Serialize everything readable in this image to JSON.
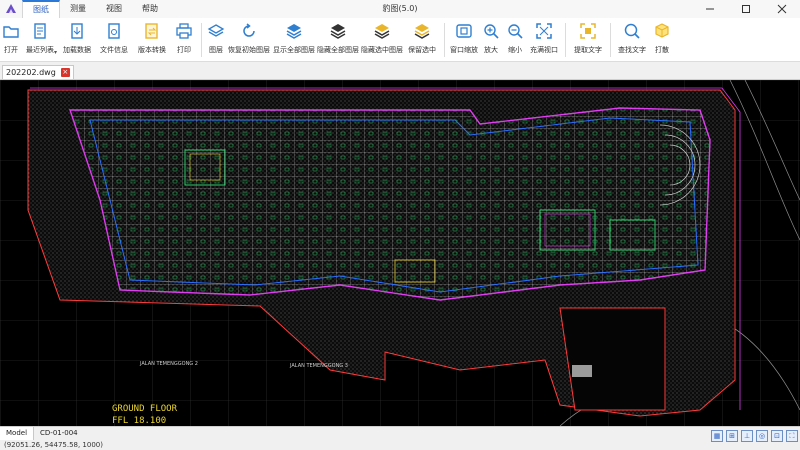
{
  "window": {
    "title": "豹图(5.0)"
  },
  "menu_tabs": [
    {
      "label": "图纸",
      "active": true
    },
    {
      "label": "测量"
    },
    {
      "label": "视图"
    },
    {
      "label": "帮助"
    }
  ],
  "ribbon": {
    "open": "打开",
    "recent": "最近列表",
    "load_data": "加载数据",
    "file_info": "文件信息",
    "version_convert": "版本转换",
    "print": "打印",
    "layers": "图层",
    "restore_layers": "恢复初始图层",
    "show_all_layers": "显示全部图层",
    "hide_all_layers": "隐藏全部图层",
    "hide_selected_layers": "隐藏选中图层",
    "keep_selected": "保留选中",
    "window_zoom": "窗口缩放",
    "zoom_in": "放大",
    "zoom_out": "缩小",
    "fill_viewport": "充满视口",
    "extract_text": "提取文字",
    "find_text": "查找文字",
    "hit": "打散"
  },
  "document": {
    "tab_name": "202202.dwg",
    "close_label": "×"
  },
  "drawing": {
    "title": "GROUND FLOOR",
    "ffl": "FFL 18.100",
    "road_left": "JALAN TEMENGGONG 2",
    "road_right": "JALAN TEMENGGONG 3"
  },
  "layout_tabs": [
    {
      "label": "Model",
      "active": true
    },
    {
      "label": "CD-01-004"
    }
  ],
  "status": {
    "coordinates": "(92051.26, 54475.58, 1000)",
    "icons": [
      "grid-icon",
      "snap-icon",
      "ortho-icon",
      "polar-icon",
      "osnap-icon",
      "fullscreen-icon"
    ]
  },
  "colors": {
    "accent": "#2a78d8",
    "canvas": "#000000",
    "ribbon_icon": "#2f7fd1",
    "yellow_icon": "#e9b62b"
  }
}
